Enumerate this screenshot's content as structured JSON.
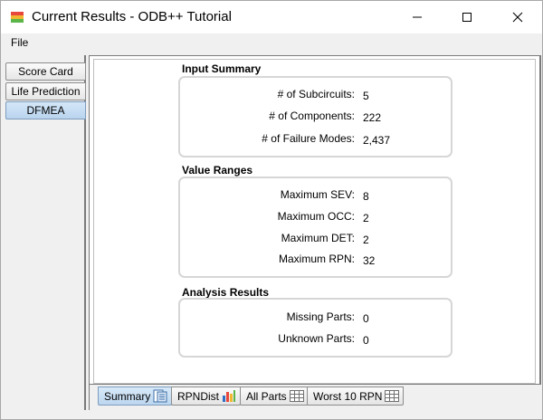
{
  "window": {
    "title": "Current Results - ODB++ Tutorial"
  },
  "menu": {
    "file_label": "File"
  },
  "side_tabs": [
    {
      "label": "Score Card"
    },
    {
      "label": "Life Prediction"
    },
    {
      "label": "DFMEA"
    }
  ],
  "input_summary": {
    "title": "Input Summary",
    "rows": [
      {
        "label": "# of Subcircuits:",
        "value": "5"
      },
      {
        "label": "# of Components:",
        "value": "222"
      },
      {
        "label": "# of Failure Modes:",
        "value": "2,437"
      }
    ]
  },
  "value_ranges": {
    "title": "Value Ranges",
    "rows": [
      {
        "label": "Maximum SEV:",
        "value": "8"
      },
      {
        "label": "Maximum OCC:",
        "value": "2"
      },
      {
        "label": "Maximum DET:",
        "value": "2"
      },
      {
        "label": "Maximum RPN:",
        "value": "32"
      }
    ]
  },
  "analysis_results": {
    "title": "Analysis Results",
    "rows": [
      {
        "label": "Missing Parts:",
        "value": "0"
      },
      {
        "label": "Unknown Parts:",
        "value": "0"
      }
    ]
  },
  "bottom_tabs": [
    {
      "label": "Summary",
      "icon": "summary-document-icon"
    },
    {
      "label": "RPNDist",
      "icon": "bar-chart-icon"
    },
    {
      "label": "All Parts",
      "icon": "table-grid-icon"
    },
    {
      "label": "Worst 10 RPN",
      "icon": "table-grid-icon"
    }
  ],
  "colors": {
    "active_tab": "#bcd6ef",
    "group_border": "#d6d6d6",
    "panel_bg": "#f0f0f0"
  }
}
